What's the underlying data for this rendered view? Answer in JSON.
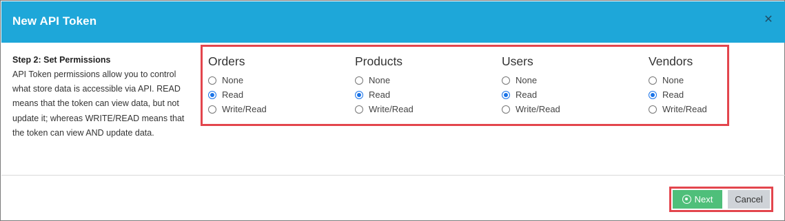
{
  "dialog": {
    "title": "New API Token",
    "close_icon": "✕"
  },
  "step": {
    "title": "Step 2: Set Permissions",
    "description": "API Token permissions allow you to control what store data is accessible via API. READ means that the token can view data, but not update it; whereas WRITE/READ means that the token can view AND update data."
  },
  "permissions": {
    "options": [
      "None",
      "Read",
      "Write/Read"
    ],
    "groups": [
      {
        "title": "Orders",
        "selected": "Read"
      },
      {
        "title": "Products",
        "selected": "Read"
      },
      {
        "title": "Users",
        "selected": "Read"
      },
      {
        "title": "Vendors",
        "selected": "Read"
      }
    ]
  },
  "footer": {
    "next_label": "Next",
    "cancel_label": "Cancel"
  },
  "colors": {
    "header": "#1ea7d9",
    "highlight_border": "#e3454d",
    "next_button": "#4fbf7a",
    "cancel_button": "#cfd3d8",
    "radio_checked": "#1a73e8"
  }
}
